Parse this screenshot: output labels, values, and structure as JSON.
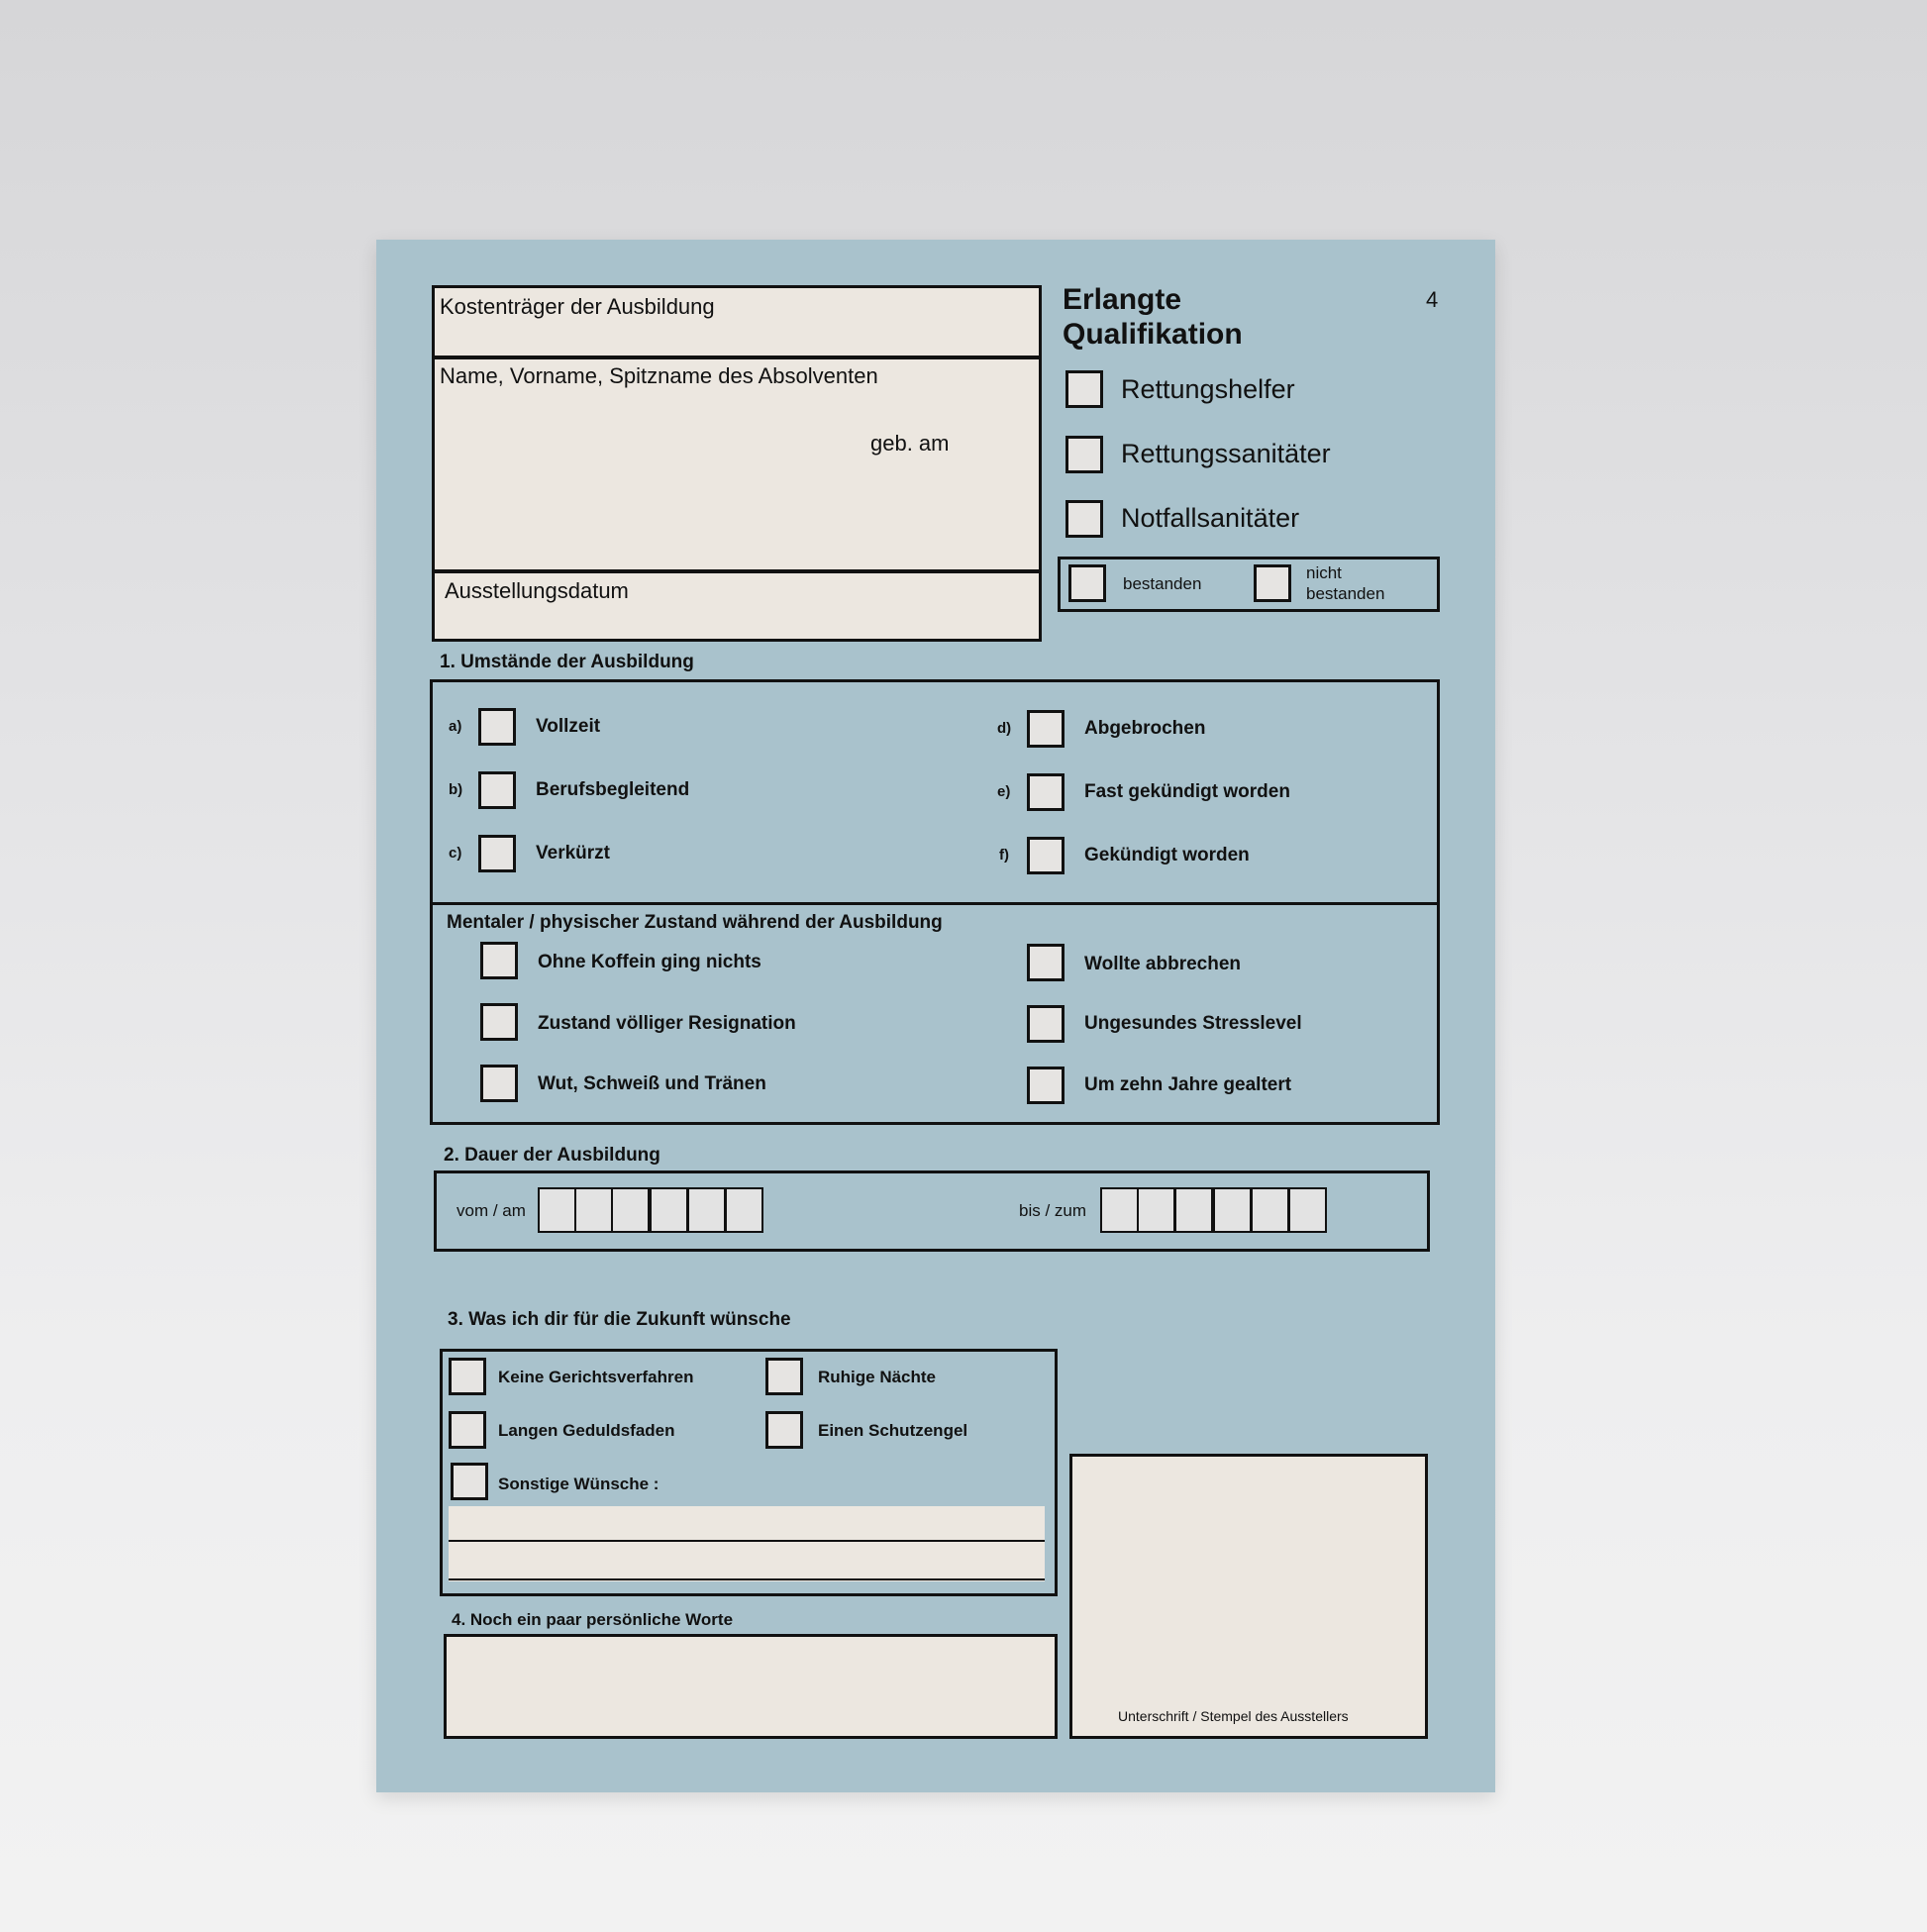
{
  "page_number": "4",
  "header_fields": {
    "payer_label": "Kostenträger der Ausbildung",
    "name_label": "Name, Vorname, Spitzname des Absolventen",
    "birth_label": "geb. am",
    "issue_date_label": "Ausstellungsdatum"
  },
  "qualification": {
    "title_line1": "Erlangte",
    "title_line2": "Qualifikation",
    "options": [
      "Rettungshelfer",
      "Rettungssanitäter",
      "Notfallsanitäter"
    ],
    "passed_label": "bestanden",
    "failed_label_line1": "nicht",
    "failed_label_line2": "bestanden"
  },
  "section1": {
    "title": "1. Umstände der Ausbildung",
    "left_items": [
      {
        "letter": "a)",
        "label": "Vollzeit"
      },
      {
        "letter": "b)",
        "label": "Berufsbegleitend"
      },
      {
        "letter": "c)",
        "label": "Verkürzt"
      }
    ],
    "right_items": [
      {
        "letter": "d)",
        "label": "Abgebrochen"
      },
      {
        "letter": "e)",
        "label": "Fast gekündigt worden"
      },
      {
        "letter": "f)",
        "label": "Gekündigt worden"
      }
    ],
    "mental_title": "Mentaler / physischer Zustand während der Ausbildung",
    "mental_left": [
      "Ohne Koffein ging nichts",
      "Zustand völliger Resignation",
      "Wut, Schweiß und Tränen"
    ],
    "mental_right": [
      "Wollte abbrechen",
      "Ungesundes Stresslevel",
      "Um zehn Jahre gealtert"
    ]
  },
  "section2": {
    "title": "2. Dauer der Ausbildung",
    "from_label": "vom / am",
    "to_label": "bis / zum"
  },
  "section3": {
    "title": "3. Was ich dir für die Zukunft wünsche",
    "items_left": [
      "Keine Gerichtsverfahren",
      "Langen Geduldsfaden"
    ],
    "items_right": [
      "Ruhige Nächte",
      "Einen Schutzengel"
    ],
    "other_label": "Sonstige Wünsche :"
  },
  "section4": {
    "title": "4. Noch ein paar persönliche Worte"
  },
  "signature_label": "Unterschrift / Stempel des Ausstellers",
  "colors": {
    "card": "#a9c2cc",
    "field": "#ece7e0",
    "ink": "#111111"
  }
}
